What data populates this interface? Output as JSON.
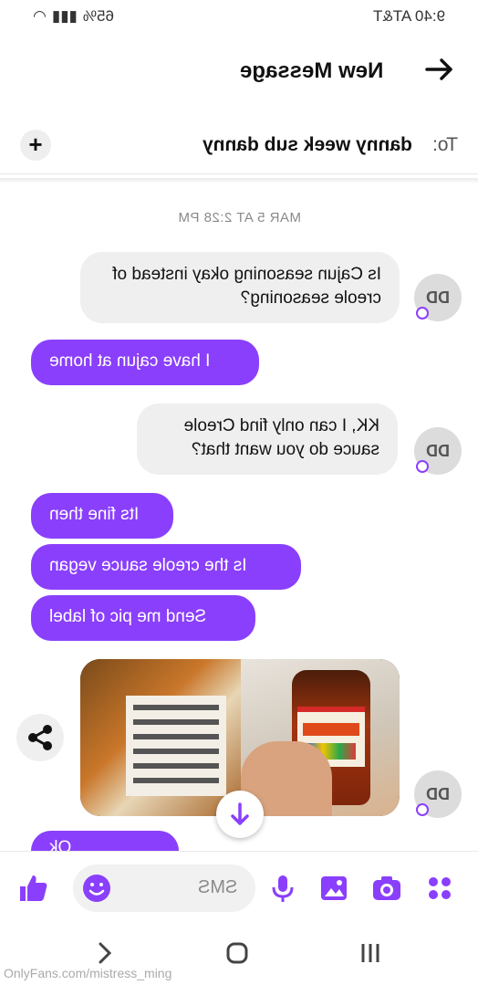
{
  "status_bar": {
    "time": "9:40 AT&T",
    "battery": "65%"
  },
  "header": {
    "title": "New Message",
    "back_icon": "arrow-icon"
  },
  "to_row": {
    "label": "To:",
    "recipient": "danny week sub danny",
    "add_icon": "plus-icon"
  },
  "chat": {
    "timestamp": "MAR 5 AT 2:28 PM",
    "messages": [
      {
        "side": "in",
        "text": "Is Cajun seasoning okay instead of creole seasoning?",
        "avatar": "DD"
      },
      {
        "side": "out",
        "text": "I have cajun at home"
      },
      {
        "side": "in",
        "text": "KK, I can only find Creole sauce do you want that?",
        "avatar": "DD"
      },
      {
        "side": "out",
        "text": "Its fine then"
      },
      {
        "side": "out",
        "text": "Is the creole sauce vegan"
      },
      {
        "side": "out",
        "text": "Send me pic of label"
      },
      {
        "side": "in",
        "type": "media",
        "avatar": "DD"
      },
      {
        "side": "out",
        "text": "Ok"
      }
    ]
  },
  "composer": {
    "placeholder": "SMS"
  },
  "watermark": "OnlyFans.com/mistress_ming",
  "colors": {
    "accent": "#8a3ffc",
    "incoming_bubble": "#efefef"
  }
}
